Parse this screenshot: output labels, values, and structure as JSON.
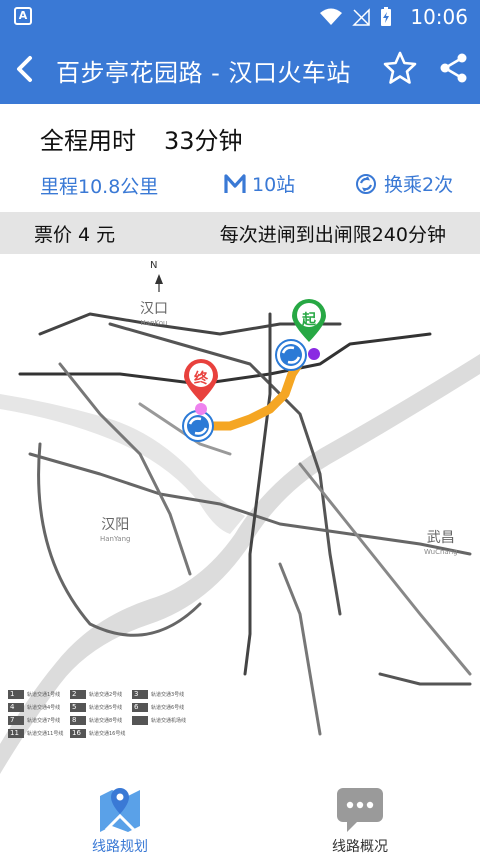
{
  "status_bar": {
    "app_badge": "A",
    "time": "10:06"
  },
  "header": {
    "title": "百步亭花园路 - 汉口火车站"
  },
  "summary": {
    "duration_label": "全程用时",
    "duration_value": "33分钟",
    "distance": "里程10.8公里",
    "stations": "10站",
    "transfers": "换乘2次"
  },
  "fare_bar": {
    "fare": "票价 4 元",
    "time_limit": "每次进闸到出闸限240分钟"
  },
  "map": {
    "compass": "N",
    "start_marker": "起",
    "end_marker": "终",
    "districts": [
      {
        "zh": "汉口",
        "en": "HanKou"
      },
      {
        "zh": "汉阳",
        "en": "HanYang"
      },
      {
        "zh": "武昌",
        "en": "WuChang"
      }
    ],
    "legend": [
      {
        "num": "1",
        "text": "轨道交通1号线"
      },
      {
        "num": "2",
        "text": "轨道交通2号线"
      },
      {
        "num": "3",
        "text": "轨道交通3号线"
      },
      {
        "num": "4",
        "text": "轨道交通4号线"
      },
      {
        "num": "5",
        "text": "轨道交通5号线"
      },
      {
        "num": "6",
        "text": "轨道交通6号线"
      },
      {
        "num": "7",
        "text": "轨道交通7号线"
      },
      {
        "num": "8",
        "text": "轨道交通8号线"
      },
      {
        "num": "",
        "text": "轨道交通机场线"
      },
      {
        "num": "11",
        "text": "轨道交通11号线"
      },
      {
        "num": "16",
        "text": "轨道交通16号线"
      }
    ],
    "colors": {
      "route": "#f5a623",
      "start": "#27a844",
      "end": "#e8413d",
      "transfer": "#2b7ad6",
      "river": "#dcdcdc"
    }
  },
  "bottom_nav": {
    "route_planning": "线路规划",
    "line_overview": "线路概况"
  }
}
